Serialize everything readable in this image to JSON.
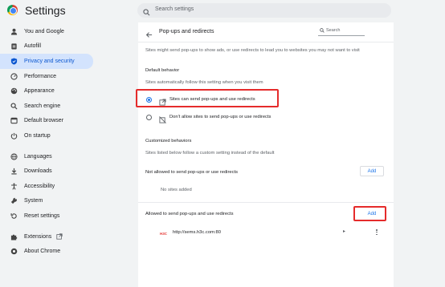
{
  "app": {
    "title": "Settings"
  },
  "search": {
    "placeholder": "Search settings"
  },
  "sidebar": {
    "items": [
      {
        "label": "You and Google",
        "icon": "person-icon"
      },
      {
        "label": "Autofill",
        "icon": "clipboard-icon"
      },
      {
        "label": "Privacy and security",
        "icon": "shield-icon",
        "active": true
      },
      {
        "label": "Performance",
        "icon": "speedometer-icon"
      },
      {
        "label": "Appearance",
        "icon": "palette-icon"
      },
      {
        "label": "Search engine",
        "icon": "search-icon"
      },
      {
        "label": "Default browser",
        "icon": "browser-icon"
      },
      {
        "label": "On startup",
        "icon": "power-icon"
      },
      {
        "label": "Languages",
        "icon": "globe-icon"
      },
      {
        "label": "Downloads",
        "icon": "download-icon"
      },
      {
        "label": "Accessibility",
        "icon": "accessibility-icon"
      },
      {
        "label": "System",
        "icon": "wrench-icon"
      },
      {
        "label": "Reset settings",
        "icon": "reset-icon"
      },
      {
        "label": "Extensions",
        "icon": "puzzle-icon"
      },
      {
        "label": "About Chrome",
        "icon": "chrome-icon"
      }
    ]
  },
  "page": {
    "title": "Pop-ups and redirects",
    "search_placeholder": "Search",
    "description": "Sites might send pop-ups to show ads, or use redirects to lead you to websites you may not want to visit",
    "default_behavior": {
      "heading": "Default behavior",
      "subtext": "Sites automatically follow this setting when you visit them",
      "options": [
        {
          "label": "Sites can send pop-ups and use redirects",
          "selected": true
        },
        {
          "label": "Don't allow sites to send pop-ups or use redirects",
          "selected": false
        }
      ]
    },
    "customized": {
      "heading": "Customized behaviors",
      "subtext": "Sites listed below follow a custom setting instead of the default",
      "not_allowed": {
        "label": "Not allowed to send pop-ups or use redirects",
        "add_label": "Add",
        "empty_text": "No sites added"
      },
      "allowed": {
        "label": "Allowed to send pop-ups and use redirects",
        "add_label": "Add",
        "sites": [
          {
            "favicon_text": "H3C",
            "url": "http://sems.h3c.com:80"
          }
        ]
      }
    }
  },
  "colors": {
    "accent": "#1a73e8",
    "highlight": "#e52b2b",
    "active_nav_bg": "#d3e3fd"
  }
}
